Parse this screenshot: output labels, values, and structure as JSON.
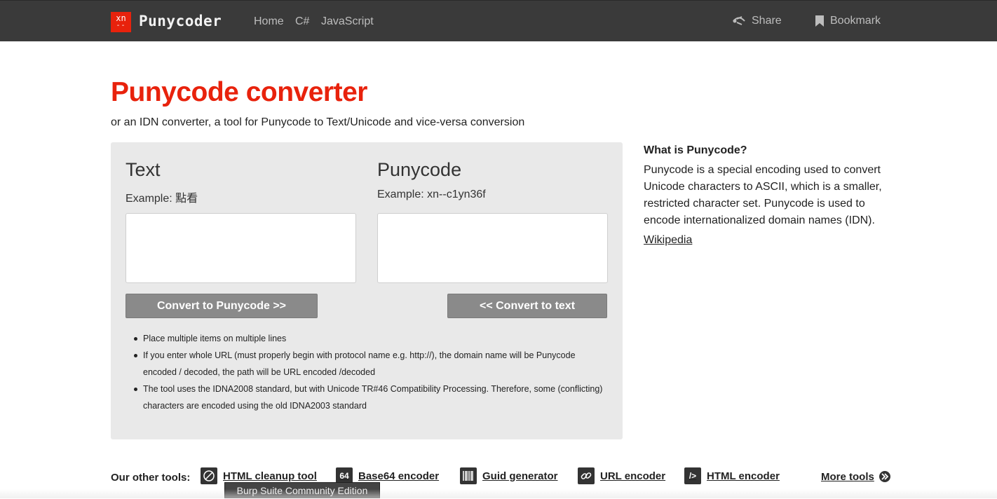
{
  "header": {
    "logo_top": "xn",
    "logo_bottom": "--",
    "brand": "Punycoder",
    "nav": [
      "Home",
      "C#",
      "JavaScript"
    ],
    "share": "Share",
    "bookmark": "Bookmark"
  },
  "page": {
    "title": "Punycode converter",
    "subtitle": "or an IDN converter, a tool for Punycode to Text/Unicode and vice-versa conversion"
  },
  "converter": {
    "text_heading": "Text",
    "text_example": "Example: 點看",
    "text_value": "",
    "puny_heading": "Punycode",
    "puny_example": "Example: xn--c1yn36f",
    "puny_value": "",
    "to_puny_button": "Convert to Punycode >>",
    "to_text_button": "<< Convert to text",
    "notes": {
      "n1": "Place multiple items on multiple lines",
      "n2": "If you enter whole URL (must properly begin with protocol name e.g. http://), the domain name will be Punycode encoded / decoded, the path will be URL encoded /decoded",
      "n3_before": "The tool uses the IDNA2008 standard, but with ",
      "n3_link": "Unicode TR#46 Compatibility Processing",
      "n3_after": ". Therefore, some (conflicting) characters are encoded using the old IDNA2003 standard"
    }
  },
  "sidebar": {
    "heading": "What is Punycode?",
    "body": "Punycode is a special encoding used to convert Unicode characters to ASCII, which is a smaller, restricted character set. Punycode is used to encode internationalized domain names (IDN).",
    "link": "Wikipedia"
  },
  "footer": {
    "label": "Our other tools:",
    "tools": [
      {
        "label": "HTML cleanup tool",
        "icon": "html-cleanup-icon"
      },
      {
        "label": "Base64 encoder",
        "icon": "base64-icon",
        "icon_text": "64"
      },
      {
        "label": "Guid generator",
        "icon": "barcode-icon"
      },
      {
        "label": "URL encoder",
        "icon": "link-icon"
      },
      {
        "label": "HTML encoder",
        "icon": "code-icon",
        "icon_text": "/>"
      }
    ],
    "more": "More tools"
  },
  "tooltip": "Burp Suite Community Edition",
  "colors": {
    "accent": "#e8220c",
    "topbar": "#3a3a3a",
    "panel": "#e9e9e9",
    "button": "#8a8a8a"
  }
}
